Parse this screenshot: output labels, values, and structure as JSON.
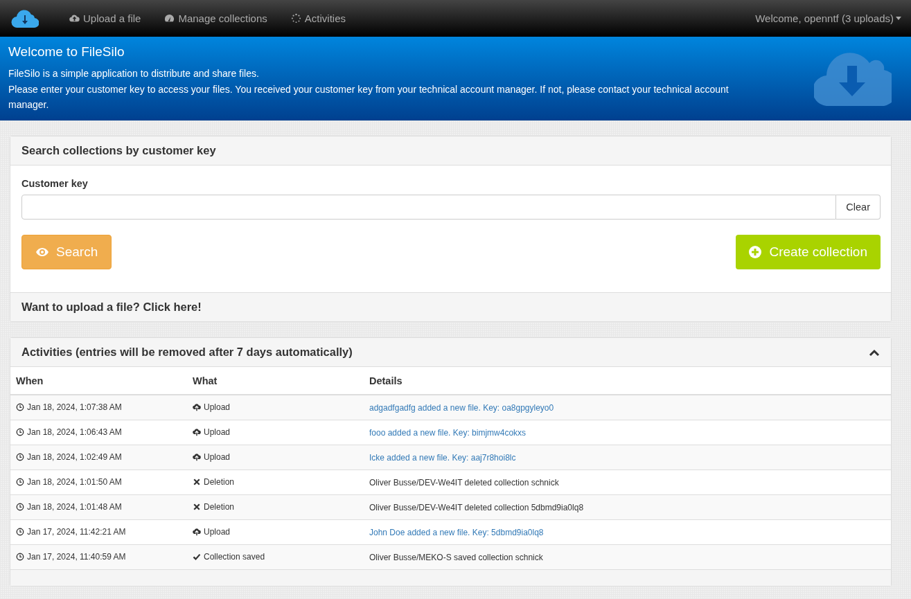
{
  "navbar": {
    "items": [
      {
        "kind": "upload",
        "label": "Upload a file"
      },
      {
        "kind": "manage",
        "label": "Manage collections"
      },
      {
        "kind": "activities",
        "label": "Activities"
      }
    ],
    "user_menu": "Welcome, openntf (3 uploads)"
  },
  "hero": {
    "title": "Welcome to FileSilo",
    "lines": [
      "FileSilo is a simple application to distribute and share files.",
      "Please enter your customer key to access your files. You received your customer key from your technical account manager. If not, please contact your technical account manager."
    ]
  },
  "search_panel": {
    "title": "Search collections by customer key",
    "field_label": "Customer key",
    "clear_button": "Clear",
    "search_button": "Search",
    "create_button": "Create collection",
    "footer": "Want to upload a file? Click here!"
  },
  "activities": {
    "title": "Activities (entries will be removed after 7 days automatically)",
    "expanded": true,
    "columns": [
      "When",
      "What",
      "Details"
    ],
    "rows": [
      {
        "when": "Jan 18, 2024, 1:07:38 AM",
        "kind": "upload",
        "what": "Upload",
        "details": "adgadfgadfg added a new file. Key: oa8gpgyleyo0",
        "link": true
      },
      {
        "when": "Jan 18, 2024, 1:06:43 AM",
        "kind": "upload",
        "what": "Upload",
        "details": "fooo added a new file. Key: bimjmw4cokxs",
        "link": true
      },
      {
        "when": "Jan 18, 2024, 1:02:49 AM",
        "kind": "upload",
        "what": "Upload",
        "details": "Icke added a new file. Key: aaj7r8hoi8lc",
        "link": true
      },
      {
        "when": "Jan 18, 2024, 1:01:50 AM",
        "kind": "deletion",
        "what": "Deletion",
        "details": "Oliver Busse/DEV-We4IT deleted collection schnick",
        "link": false
      },
      {
        "when": "Jan 18, 2024, 1:01:48 AM",
        "kind": "deletion",
        "what": "Deletion",
        "details": "Oliver Busse/DEV-We4IT deleted collection 5dbmd9ia0lq8",
        "link": false
      },
      {
        "when": "Jan 17, 2024, 11:42:21 AM",
        "kind": "upload",
        "what": "Upload",
        "details": "John Doe added a new file. Key: 5dbmd9ia0lq8",
        "link": true
      },
      {
        "when": "Jan 17, 2024, 11:40:59 AM",
        "kind": "saved",
        "what": "Collection saved",
        "details": "Oliver Busse/MEKO-S saved collection schnick",
        "link": false
      }
    ]
  }
}
